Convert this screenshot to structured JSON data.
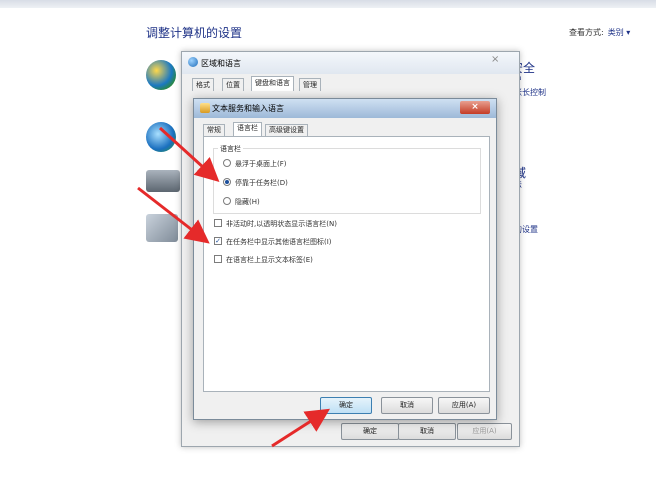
{
  "control_panel": {
    "title": "调整计算机的设置",
    "view_by_label": "查看方式:",
    "view_by_value": "类别 ▾",
    "security": {
      "title": "安全",
      "sub1": "户",
      "sub2": "帐长控制"
    },
    "region": {
      "title": "域",
      "sub": "法",
      "link": "的设置"
    }
  },
  "region_dialog": {
    "title": "区域和语言",
    "close": "×",
    "tabs": [
      "格式",
      "位置",
      "键盘和语言",
      "管理"
    ],
    "buttons": {
      "ok": "确定",
      "cancel": "取消",
      "apply": "应用(A)"
    }
  },
  "text_services_dialog": {
    "title": "文本服务和输入语言",
    "close": "×",
    "tabs": [
      "常规",
      "语言栏",
      "高级键设置"
    ],
    "group_label": "语言栏",
    "radios": [
      {
        "label": "悬浮于桌面上(F)",
        "selected": false
      },
      {
        "label": "停靠于任务栏(D)",
        "selected": true
      },
      {
        "label": "隐藏(H)",
        "selected": false
      }
    ],
    "checkboxes": [
      {
        "label": "非活动时,以透明状态显示语言栏(N)",
        "checked": false
      },
      {
        "label": "在任务栏中显示其他语言栏图标(I)",
        "checked": true
      },
      {
        "label": "在语言栏上显示文本标签(E)",
        "checked": false
      }
    ],
    "buttons": {
      "ok": "确定",
      "cancel": "取消",
      "apply": "应用(A)"
    }
  },
  "colors": {
    "link": "#1e3287",
    "annotation_arrow": "#e52a2a"
  }
}
